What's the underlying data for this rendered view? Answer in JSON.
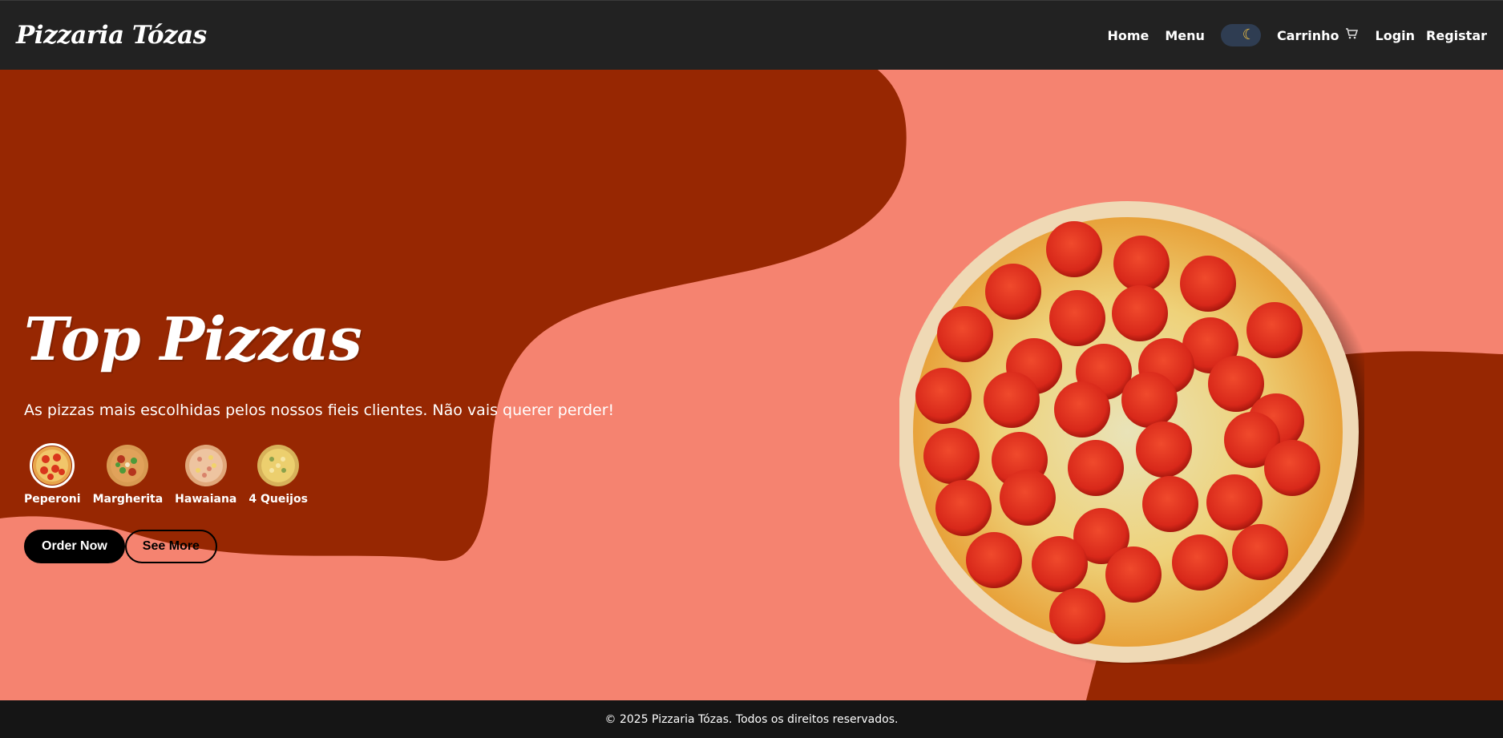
{
  "navbar": {
    "brand": "Pizzaria Tózas",
    "links": {
      "home": "Home",
      "menu": "Menu",
      "cart": "Carrinho",
      "login": "Login",
      "register": "Registar"
    },
    "theme_toggle_icon": "moon-icon",
    "cart_icon": "cart-icon"
  },
  "hero": {
    "title": "Top Pizzas",
    "subtitle": "As pizzas mais escolhidas pelos nossos fieis clientes. Não vais querer perder!",
    "flavors": [
      {
        "label": "Peperoni",
        "active": true
      },
      {
        "label": "Margherita",
        "active": false
      },
      {
        "label": "Hawaiana",
        "active": false
      },
      {
        "label": "4 Queijos",
        "active": false
      }
    ],
    "buttons": {
      "primary": "Order Now",
      "secondary": "See More"
    }
  },
  "footer": {
    "text": "© 2025 Pizzaria Tózas. Todos os direitos reservados."
  },
  "colors": {
    "navbar_bg": "#222222",
    "hero_bg": "#f58370",
    "blob": "#972702",
    "footer_bg": "#151515",
    "button_primary": "#000000"
  }
}
